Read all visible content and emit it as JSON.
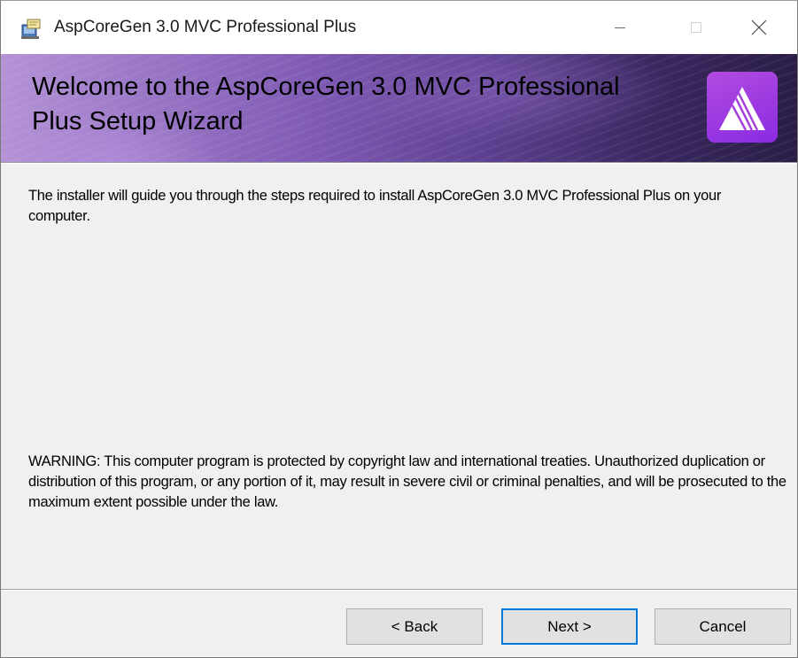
{
  "window": {
    "title": "AspCoreGen 3.0 MVC Professional Plus"
  },
  "banner": {
    "title": "Welcome to the AspCoreGen 3.0 MVC Professional Plus Setup Wizard",
    "logo_icon": "aspcoregen-logo-icon"
  },
  "body": {
    "intro": "The installer will guide you through the steps required to install AspCoreGen 3.0 MVC Professional Plus on your computer.",
    "warning": "WARNING: This computer program is protected by copyright law and international treaties. Unauthorized duplication or distribution of this program, or any portion of it, may result in severe civil or criminal penalties, and will be prosecuted to the maximum extent possible under the law."
  },
  "buttons": {
    "back": "< Back",
    "next": "Next >",
    "cancel": "Cancel"
  },
  "colors": {
    "focus_border": "#0078d7",
    "logo_purple": "#8a2be2",
    "dialog_background": "#f0f0f0"
  }
}
